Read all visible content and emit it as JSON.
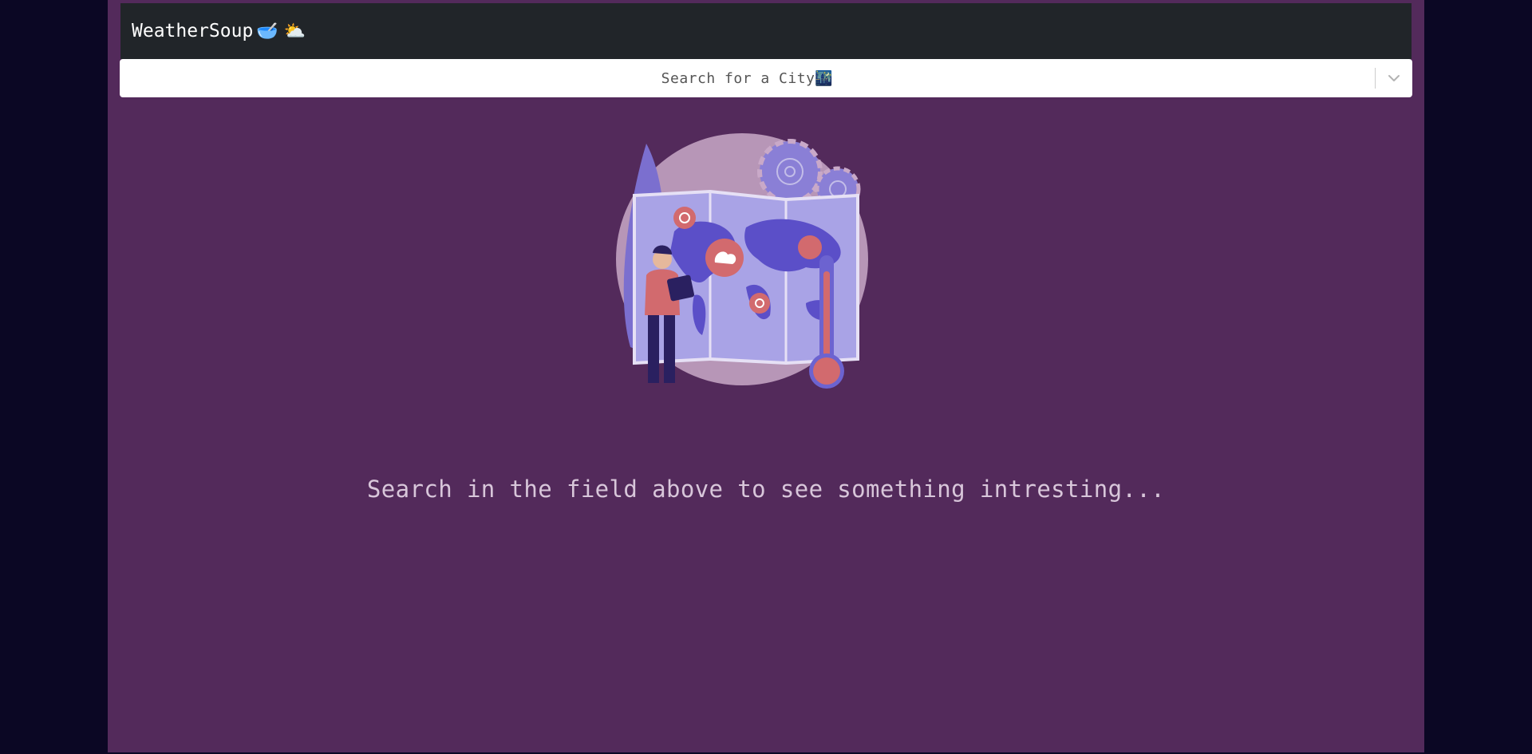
{
  "navbar": {
    "brand_text": "WeatherSoup",
    "brand_emojis": "🥣 ⛅",
    "brand_icons": [
      "soup-bowl-icon",
      "sun-behind-cloud-icon"
    ]
  },
  "search": {
    "placeholder": "Search for a City🌃",
    "dropdown_icon": "chevron-down-icon"
  },
  "main": {
    "illustration_icon": "weather-map-illustration",
    "message": "Search in the field above to see something intresting..."
  },
  "colors": {
    "page_background": "#0b0724",
    "column_background": "#532a5b",
    "navbar_background": "#212529",
    "message_text": "#d8c6da"
  }
}
